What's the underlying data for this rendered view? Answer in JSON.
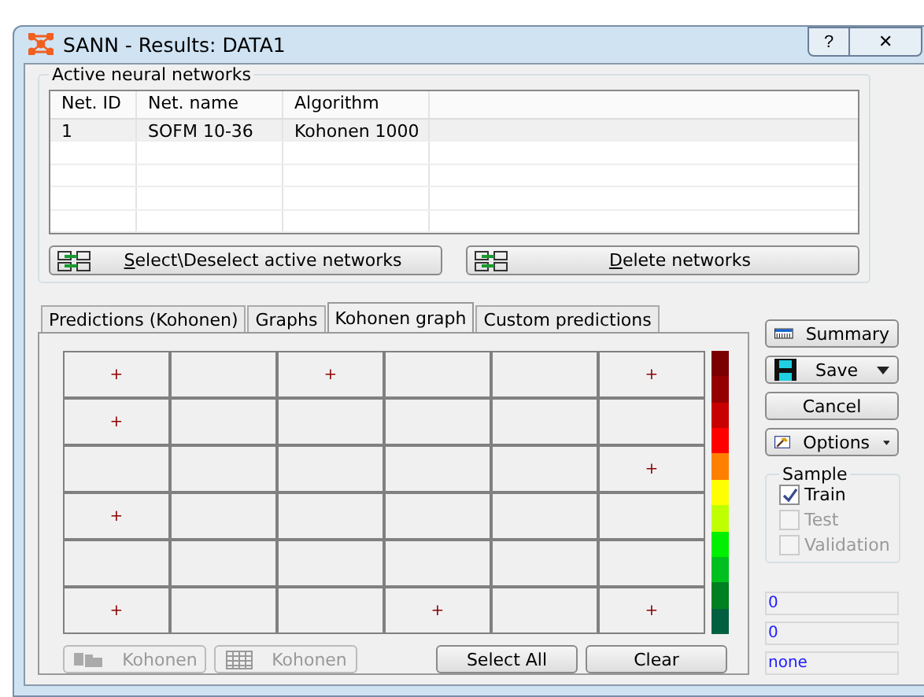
{
  "window": {
    "title": "SANN - Results: DATA1",
    "help": "?",
    "close": "✕"
  },
  "networks": {
    "title": "Active neural networks",
    "columns": [
      "Net. ID",
      "Net. name",
      "Algorithm"
    ],
    "rows": [
      [
        "1",
        "SOFM 10-36",
        "Kohonen 1000"
      ]
    ],
    "buttons": [
      {
        "mnemonic": "S",
        "rest": "elect\\Deselect active networks"
      },
      {
        "mnemonic": "D",
        "rest": "elete networks"
      }
    ]
  },
  "tabs": [
    {
      "label": "Predictions (Kohonen)",
      "selected": false
    },
    {
      "label": "Graphs",
      "selected": false
    },
    {
      "label": "Kohonen graph",
      "selected": true
    },
    {
      "label": "Custom predictions",
      "selected": false
    }
  ],
  "kohonen_grid": [
    [
      true,
      false,
      true,
      false,
      false,
      true
    ],
    [
      true,
      false,
      false,
      false,
      false,
      false
    ],
    [
      false,
      false,
      false,
      false,
      false,
      true
    ],
    [
      true,
      false,
      false,
      false,
      false,
      false
    ],
    [
      false,
      false,
      false,
      false,
      false,
      false
    ],
    [
      true,
      false,
      false,
      true,
      false,
      true
    ]
  ],
  "marker": "+",
  "color_scale": [
    {
      "color": "#7a0000"
    },
    {
      "color": "#940000"
    },
    {
      "color": "#c80000"
    },
    {
      "color": "#ff0000"
    },
    {
      "color": "#ff8000"
    },
    {
      "color": "#ffff00"
    },
    {
      "color": "#c0ff00"
    },
    {
      "color": "#00f000"
    },
    {
      "color": "#00c020"
    },
    {
      "color": "#008020"
    },
    {
      "color": "#006040"
    }
  ],
  "panel_buttons": [
    {
      "label": "Kohonen",
      "disabled": true,
      "kind": "topo"
    },
    {
      "label": "Kohonen",
      "disabled": true,
      "kind": "grid"
    },
    {
      "label": "Select All",
      "disabled": false,
      "kind": "plain"
    },
    {
      "label": "Clear",
      "disabled": false,
      "kind": "plain"
    }
  ],
  "side_buttons": [
    {
      "label": "Summary",
      "kind": "summary",
      "dropdown": false
    },
    {
      "label": "Save",
      "kind": "save",
      "dropdown": true
    },
    {
      "label": "Cancel",
      "kind": "plain",
      "dropdown": false
    },
    {
      "label": "Options",
      "kind": "options",
      "dropdown": true
    }
  ],
  "sample": {
    "title": "Sample",
    "items": [
      {
        "label": "Train",
        "checked": true,
        "disabled": false
      },
      {
        "label": "Test",
        "checked": false,
        "disabled": true
      },
      {
        "label": "Validation",
        "checked": false,
        "disabled": true
      }
    ]
  },
  "status_fields": [
    "0",
    "0",
    "none"
  ]
}
